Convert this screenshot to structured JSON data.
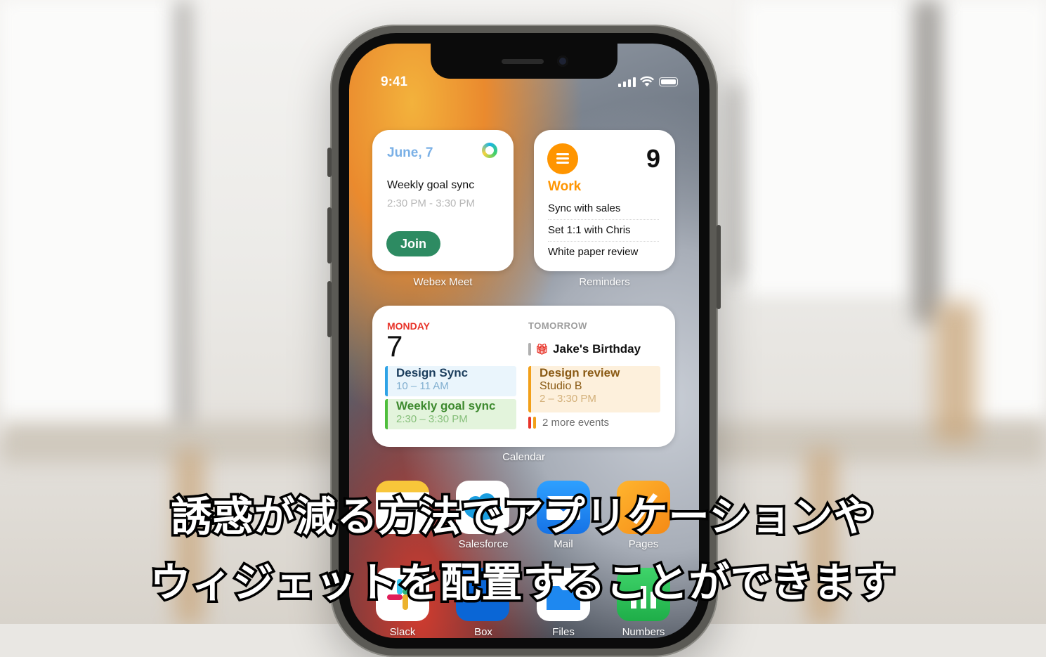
{
  "status_bar": {
    "time": "9:41"
  },
  "webex_widget": {
    "date": "June, 7",
    "meeting_title": "Weekly goal sync",
    "meeting_time": "2:30 PM - 3:30 PM",
    "join_label": "Join",
    "widget_label": "Webex Meet"
  },
  "reminders_widget": {
    "count": "9",
    "list_name": "Work",
    "items": [
      "Sync with sales",
      "Set 1:1 with Chris",
      "White paper review"
    ],
    "widget_label": "Reminders"
  },
  "calendar_widget": {
    "today_label": "MONDAY",
    "today_number": "7",
    "today_events": [
      {
        "title": "Design Sync",
        "time": "10 – 11 AM"
      },
      {
        "title": "Weekly goal sync",
        "time": "2:30 – 3:30 PM"
      }
    ],
    "tomorrow_label": "TOMORROW",
    "birthday": "Jake's Birthday",
    "tomorrow_event": {
      "title": "Design review",
      "location": "Studio B",
      "time": "2 – 3:30 PM"
    },
    "more_events": "2 more events",
    "widget_label": "Calendar"
  },
  "apps_row1": [
    {
      "name": "Notes",
      "label": ""
    },
    {
      "name": "Salesforce",
      "label": "Salesforce"
    },
    {
      "name": "Mail",
      "label": "Mail"
    },
    {
      "name": "Pages",
      "label": "Pages"
    }
  ],
  "apps_row2": [
    {
      "name": "Slack",
      "label": "Slack"
    },
    {
      "name": "Box",
      "label": "Box"
    },
    {
      "name": "Files",
      "label": "Files"
    },
    {
      "name": "Numbers",
      "label": "Numbers"
    }
  ],
  "subtitles": {
    "line1": "誘惑が減る方法でアプリケーションや",
    "line2": "ウィジェットを配置することができます"
  },
  "colors": {
    "accent_orange": "#ff9500",
    "calendar_red": "#e8352b",
    "webex_join_green": "#2d8b62"
  }
}
